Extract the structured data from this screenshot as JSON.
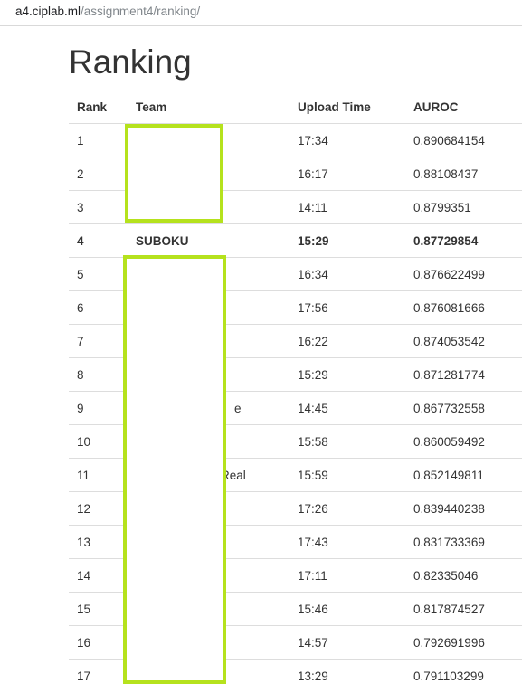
{
  "browser": {
    "url_host": "a4.ciplab.ml",
    "url_path": "/assignment4/ranking/"
  },
  "page": {
    "title": "Ranking"
  },
  "table": {
    "headers": [
      "Rank",
      "Team",
      "Upload Time",
      "AUROC"
    ],
    "rows": [
      {
        "rank": "1",
        "team": "",
        "time": "17:34",
        "auroc": "0.890684154"
      },
      {
        "rank": "2",
        "team": "",
        "time": "16:17",
        "auroc": "0.88108437"
      },
      {
        "rank": "3",
        "team": "",
        "time": "14:11",
        "auroc": "0.8799351"
      },
      {
        "rank": "4",
        "team": "SUBOKU",
        "time": "15:29",
        "auroc": "0.87729854"
      },
      {
        "rank": "5",
        "team": "",
        "time": "16:34",
        "auroc": "0.876622499"
      },
      {
        "rank": "6",
        "team": "",
        "time": "17:56",
        "auroc": "0.876081666"
      },
      {
        "rank": "7",
        "team": "",
        "time": "16:22",
        "auroc": "0.874053542"
      },
      {
        "rank": "8",
        "team": "",
        "time": "15:29",
        "auroc": "0.871281774"
      },
      {
        "rank": "9",
        "team": "e",
        "time": "14:45",
        "auroc": "0.867732558"
      },
      {
        "rank": "10",
        "team": "",
        "time": "15:58",
        "auroc": "0.860059492"
      },
      {
        "rank": "11",
        "team": "Real",
        "time": "15:59",
        "auroc": "0.852149811"
      },
      {
        "rank": "12",
        "team": "",
        "time": "17:26",
        "auroc": "0.839440238"
      },
      {
        "rank": "13",
        "team": "",
        "time": "17:43",
        "auroc": "0.831733369"
      },
      {
        "rank": "14",
        "team": "",
        "time": "17:11",
        "auroc": "0.82335046"
      },
      {
        "rank": "15",
        "team": "",
        "time": "15:46",
        "auroc": "0.817874527"
      },
      {
        "rank": "16",
        "team": "",
        "time": "14:57",
        "auroc": "0.792691996"
      },
      {
        "rank": "17",
        "team": "",
        "time": "13:29",
        "auroc": "0.791103299"
      }
    ]
  },
  "colors": {
    "redaction_border": "#b5e21d"
  }
}
